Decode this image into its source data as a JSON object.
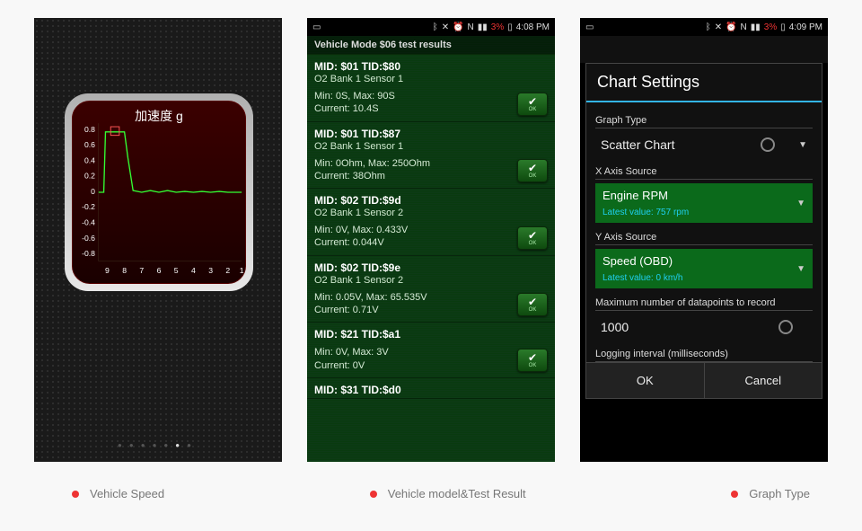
{
  "captions": {
    "c1": "Vehicle Speed",
    "c2": "Vehicle model&Test Result",
    "c3": "Graph Type"
  },
  "phone1": {
    "chart_title": "加速度 g",
    "page_index": 5,
    "page_count": 7
  },
  "chart_data": {
    "type": "line",
    "title": "加速度 g",
    "xlabel": "",
    "ylabel": "",
    "x": [
      9,
      8,
      7,
      6,
      5,
      4,
      3,
      2,
      1
    ],
    "values": [
      0.0,
      0.8,
      0.5,
      0.05,
      0.05,
      0.05,
      0.05,
      0.05,
      0.05
    ],
    "y_ticks": [
      0.8,
      0.6,
      0.4,
      0.2,
      0,
      -0.2,
      -0.4,
      -0.6,
      -0.8
    ],
    "ylim": [
      -1.0,
      1.0
    ]
  },
  "phone2": {
    "status": {
      "battery": "3%",
      "time": "4:08 PM"
    },
    "header": "Vehicle Mode $06 test results",
    "tests": [
      {
        "mid": "MID: $01 TID:$80",
        "sub": "O2 Bank 1 Sensor 1",
        "line1": "Min: 0S, Max: 90S",
        "line2": "Current: 10.4S",
        "ok": "OK"
      },
      {
        "mid": "MID: $01 TID:$87",
        "sub": "O2 Bank 1 Sensor 1",
        "line1": "Min: 0Ohm, Max: 250Ohm",
        "line2": "Current: 38Ohm",
        "ok": "OK"
      },
      {
        "mid": "MID: $02 TID:$9d",
        "sub": "O2 Bank 1 Sensor 2",
        "line1": "Min: 0V, Max: 0.433V",
        "line2": "Current: 0.044V",
        "ok": "OK"
      },
      {
        "mid": "MID: $02 TID:$9e",
        "sub": "O2 Bank 1 Sensor 2",
        "line1": "Min: 0.05V, Max: 65.535V",
        "line2": "Current: 0.71V",
        "ok": "OK"
      },
      {
        "mid": "MID: $21 TID:$a1",
        "sub": "",
        "line1": "Min: 0V, Max: 3V",
        "line2": "Current: 0V",
        "ok": "OK"
      },
      {
        "mid": "MID: $31 TID:$d0",
        "sub": "",
        "line1": "",
        "line2": "",
        "ok": ""
      }
    ]
  },
  "phone3": {
    "status": {
      "battery": "3%",
      "time": "4:09 PM"
    },
    "dialog_title": "Chart Settings",
    "fields": {
      "graph_type_label": "Graph Type",
      "graph_type_value": "Scatter Chart",
      "x_label": "X Axis Source",
      "x_value": "Engine RPM",
      "x_hint": "Latest value: 757 rpm",
      "y_label": "Y Axis Source",
      "y_value": "Speed (OBD)",
      "y_hint": "Latest value: 0 km/h",
      "max_label": "Maximum number of datapoints to record",
      "max_value": "1000",
      "interval_label": "Logging interval (milliseconds)"
    },
    "buttons": {
      "ok": "OK",
      "cancel": "Cancel"
    }
  }
}
